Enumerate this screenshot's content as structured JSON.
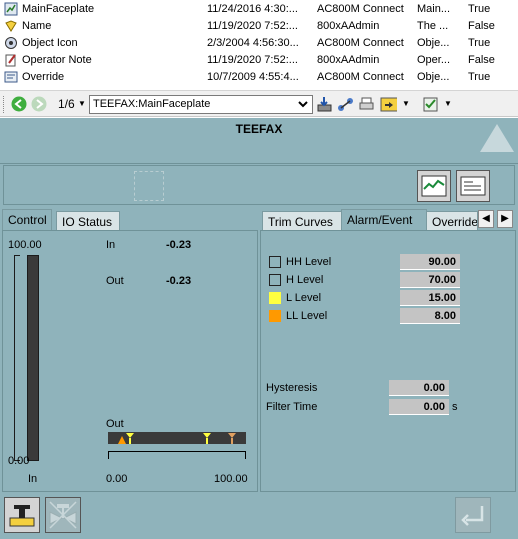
{
  "list": {
    "rows": [
      {
        "icon": "faceplate-icon",
        "name": "MainFaceplate",
        "date": "11/24/2016 4:30:...",
        "user": "AC800M Connect",
        "desc": "Main...",
        "flag": "True"
      },
      {
        "icon": "name-icon",
        "name": "Name",
        "date": "11/19/2020 7:52:...",
        "user": "800xAAdmin",
        "desc": "The ...",
        "flag": "False"
      },
      {
        "icon": "object-icon-icon",
        "name": "Object Icon",
        "date": "2/3/2004 4:56:30...",
        "user": "AC800M Connect",
        "desc": "Obje...",
        "flag": "True"
      },
      {
        "icon": "note-icon",
        "name": "Operator Note",
        "date": "11/19/2020 7:52:...",
        "user": "800xAAdmin",
        "desc": "Oper...",
        "flag": "False"
      },
      {
        "icon": "override-icon",
        "name": "Override",
        "date": "10/7/2009 4:55:4...",
        "user": "AC800M Connect",
        "desc": "Obje...",
        "flag": "True"
      }
    ]
  },
  "toolbar": {
    "path_value": "TEEFAX:MainFaceplate",
    "fraction_glyph": "1/6"
  },
  "faceplate": {
    "title": "TEEFAX",
    "tabs_left": [
      "Control",
      "IO Status"
    ],
    "tabs_right": [
      "Trim Curves",
      "Alarm/Event",
      "Override"
    ],
    "control": {
      "scale_max": "100.00",
      "scale_min": "0.00",
      "in_label": "In",
      "in_value": "-0.23",
      "out_label": "Out",
      "out_value": "-0.23",
      "bar_caption": "In",
      "out_bar_label": "Out",
      "hscale_min": "0.00",
      "hscale_max": "100.00"
    },
    "alarm": {
      "levels": [
        {
          "label": "HH Level",
          "value": "90.00",
          "color": "#8fb3bb"
        },
        {
          "label": "H Level",
          "value": "70.00",
          "color": "#8fb3bb"
        },
        {
          "label": "L Level",
          "value": "15.00",
          "color": "#ffff40"
        },
        {
          "label": "LL Level",
          "value": "8.00",
          "color": "#ff9900"
        }
      ],
      "hysteresis_label": "Hysteresis",
      "hysteresis_value": "0.00",
      "filter_label": "Filter Time",
      "filter_value": "0.00",
      "filter_unit": "s"
    }
  },
  "colors": {
    "faceplate_bg": "#8fb3bb",
    "bar_dark": "#3a3a3a",
    "value_box": "#c4c4c4"
  }
}
